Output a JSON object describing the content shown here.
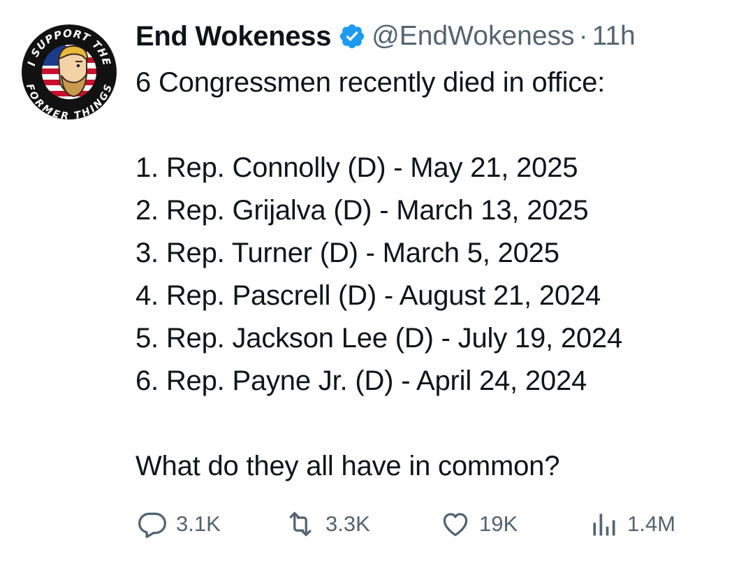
{
  "author": {
    "display_name": "End Wokeness",
    "handle": "@EndWokeness",
    "separator": "·",
    "time": "11h",
    "verified_icon": "verified-badge-icon",
    "accent_color": "#1d9bf0",
    "avatar": {
      "text_top": "I SUPPORT THE",
      "text_bottom": "FORMER THINGS"
    }
  },
  "tweet": {
    "intro": "6 Congressmen recently died in office:",
    "items": [
      "1. Rep. Connolly (D) - May 21, 2025",
      "2. Rep. Grijalva (D) - March 13, 2025",
      "3. Rep. Turner (D) - March 5, 2025",
      "4. Rep. Pascrell (D) - August 21, 2024",
      "5. Rep. Jackson Lee (D) - July 19, 2024",
      "6. Rep. Payne Jr. (D) - April 24, 2024"
    ],
    "question": "What do they all have in common?"
  },
  "actions": {
    "reply": {
      "icon": "reply-icon",
      "count": "3.1K"
    },
    "retweet": {
      "icon": "retweet-icon",
      "count": "3.3K"
    },
    "like": {
      "icon": "heart-icon",
      "count": "19K"
    },
    "views": {
      "icon": "views-icon",
      "count": "1.4M"
    }
  },
  "colors": {
    "text": "#0f1419",
    "muted": "#536471",
    "verified": "#1d9bf0"
  }
}
